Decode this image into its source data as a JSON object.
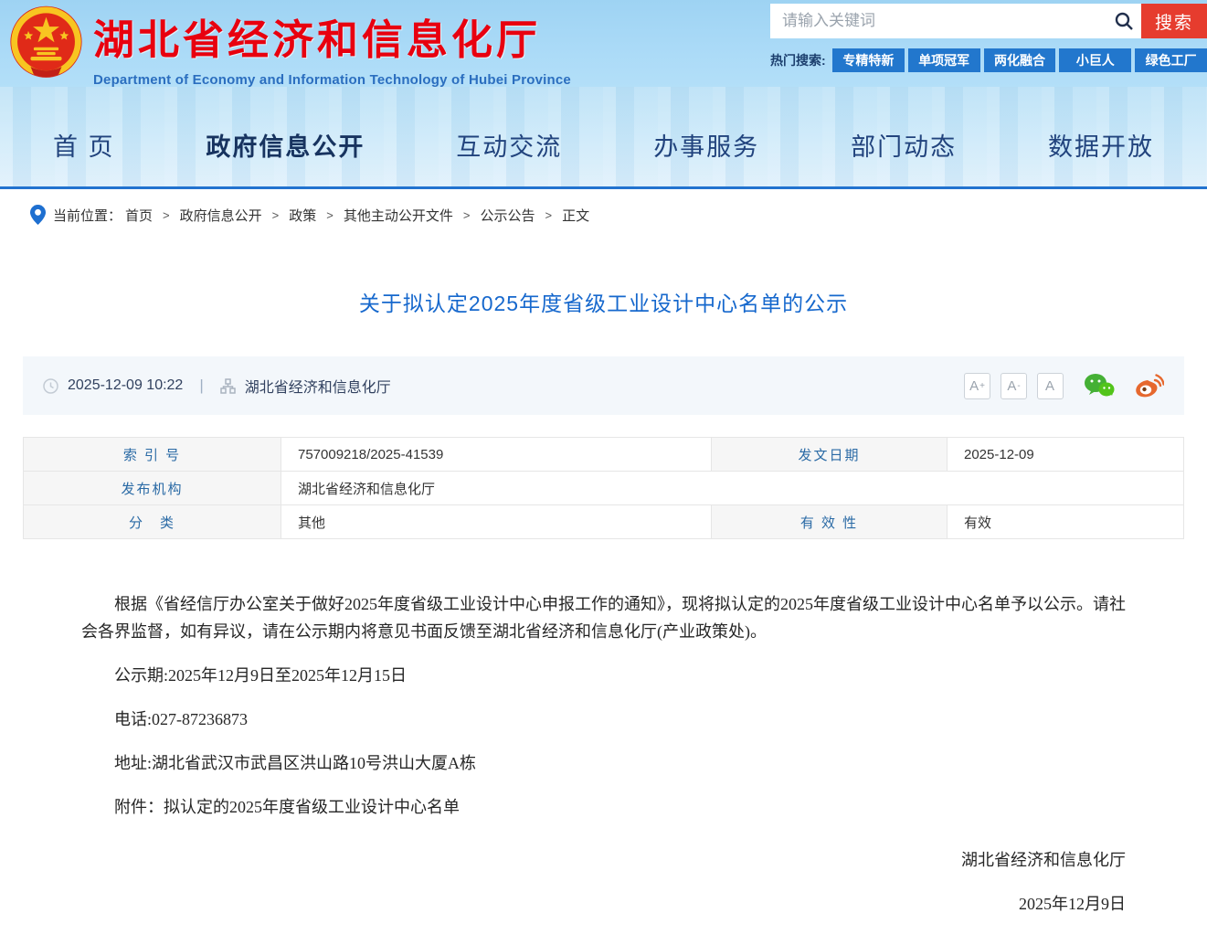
{
  "header": {
    "site_title": "湖北省经济和信息化厅",
    "site_subtitle": "Department of Economy and Information Technology of Hubei Province",
    "search": {
      "placeholder": "请输入关键词",
      "button_label": "搜索",
      "hot_label": "热门搜索:",
      "hot_tags": [
        "专精特新",
        "单项冠军",
        "两化融合",
        "小巨人",
        "绿色工厂"
      ]
    }
  },
  "nav": {
    "items": [
      {
        "label": "首 页",
        "active": false
      },
      {
        "label": "政府信息公开",
        "active": true
      },
      {
        "label": "互动交流",
        "active": false
      },
      {
        "label": "办事服务",
        "active": false
      },
      {
        "label": "部门动态",
        "active": false
      },
      {
        "label": "数据开放",
        "active": false
      }
    ]
  },
  "breadcrumb": {
    "label": "当前位置：",
    "separator": ">",
    "items": [
      "首页",
      "政府信息公开",
      "政策",
      "其他主动公开文件",
      "公示公告",
      "正文"
    ]
  },
  "article": {
    "title": "关于拟认定2025年度省级工业设计中心名单的公示",
    "meta": {
      "datetime": "2025-12-09 10:22",
      "divider": "|",
      "source": "湖北省经济和信息化厅",
      "fontsize_buttons": [
        {
          "base": "A",
          "sup": "+"
        },
        {
          "base": "A",
          "sup": "-"
        },
        {
          "base": "A",
          "sup": ""
        }
      ]
    },
    "info_table": {
      "row1": {
        "l1": "索 引 号",
        "v1": "757009218/2025-41539",
        "l2": "发文日期",
        "v2": "2025-12-09"
      },
      "row2": {
        "l1": "发布机构",
        "v1": "湖北省经济和信息化厅"
      },
      "row3": {
        "l1": "分　类",
        "v1": "其他",
        "l2": "有 效 性",
        "v2": "有效"
      }
    },
    "paragraphs": [
      "根据《省经信厅办公室关于做好2025年度省级工业设计中心申报工作的通知》，现将拟认定的2025年度省级工业设计中心名单予以公示。请社会各界监督，如有异议，请在公示期内将意见书面反馈至湖北省经济和信息化厅(产业政策处)。",
      "公示期:2025年12月9日至2025年12月15日",
      "电话:027-87236873",
      "地址:湖北省武汉市武昌区洪山路10号洪山大厦A栋",
      "附件：拟认定的2025年度省级工业设计中心名单"
    ],
    "signature": {
      "org": "湖北省经济和信息化厅",
      "date": "2025年12月9日"
    }
  },
  "colors": {
    "site_title_red": "#e8000f",
    "search_button_red": "#e63c2e",
    "hot_tag_blue": "#2277cd",
    "nav_text_blue": "#21437d",
    "article_title_blue": "#1668cd",
    "table_label_blue": "#2a6aa5",
    "wechat_green": "#45b035",
    "weibo_orange": "#e6682e"
  }
}
